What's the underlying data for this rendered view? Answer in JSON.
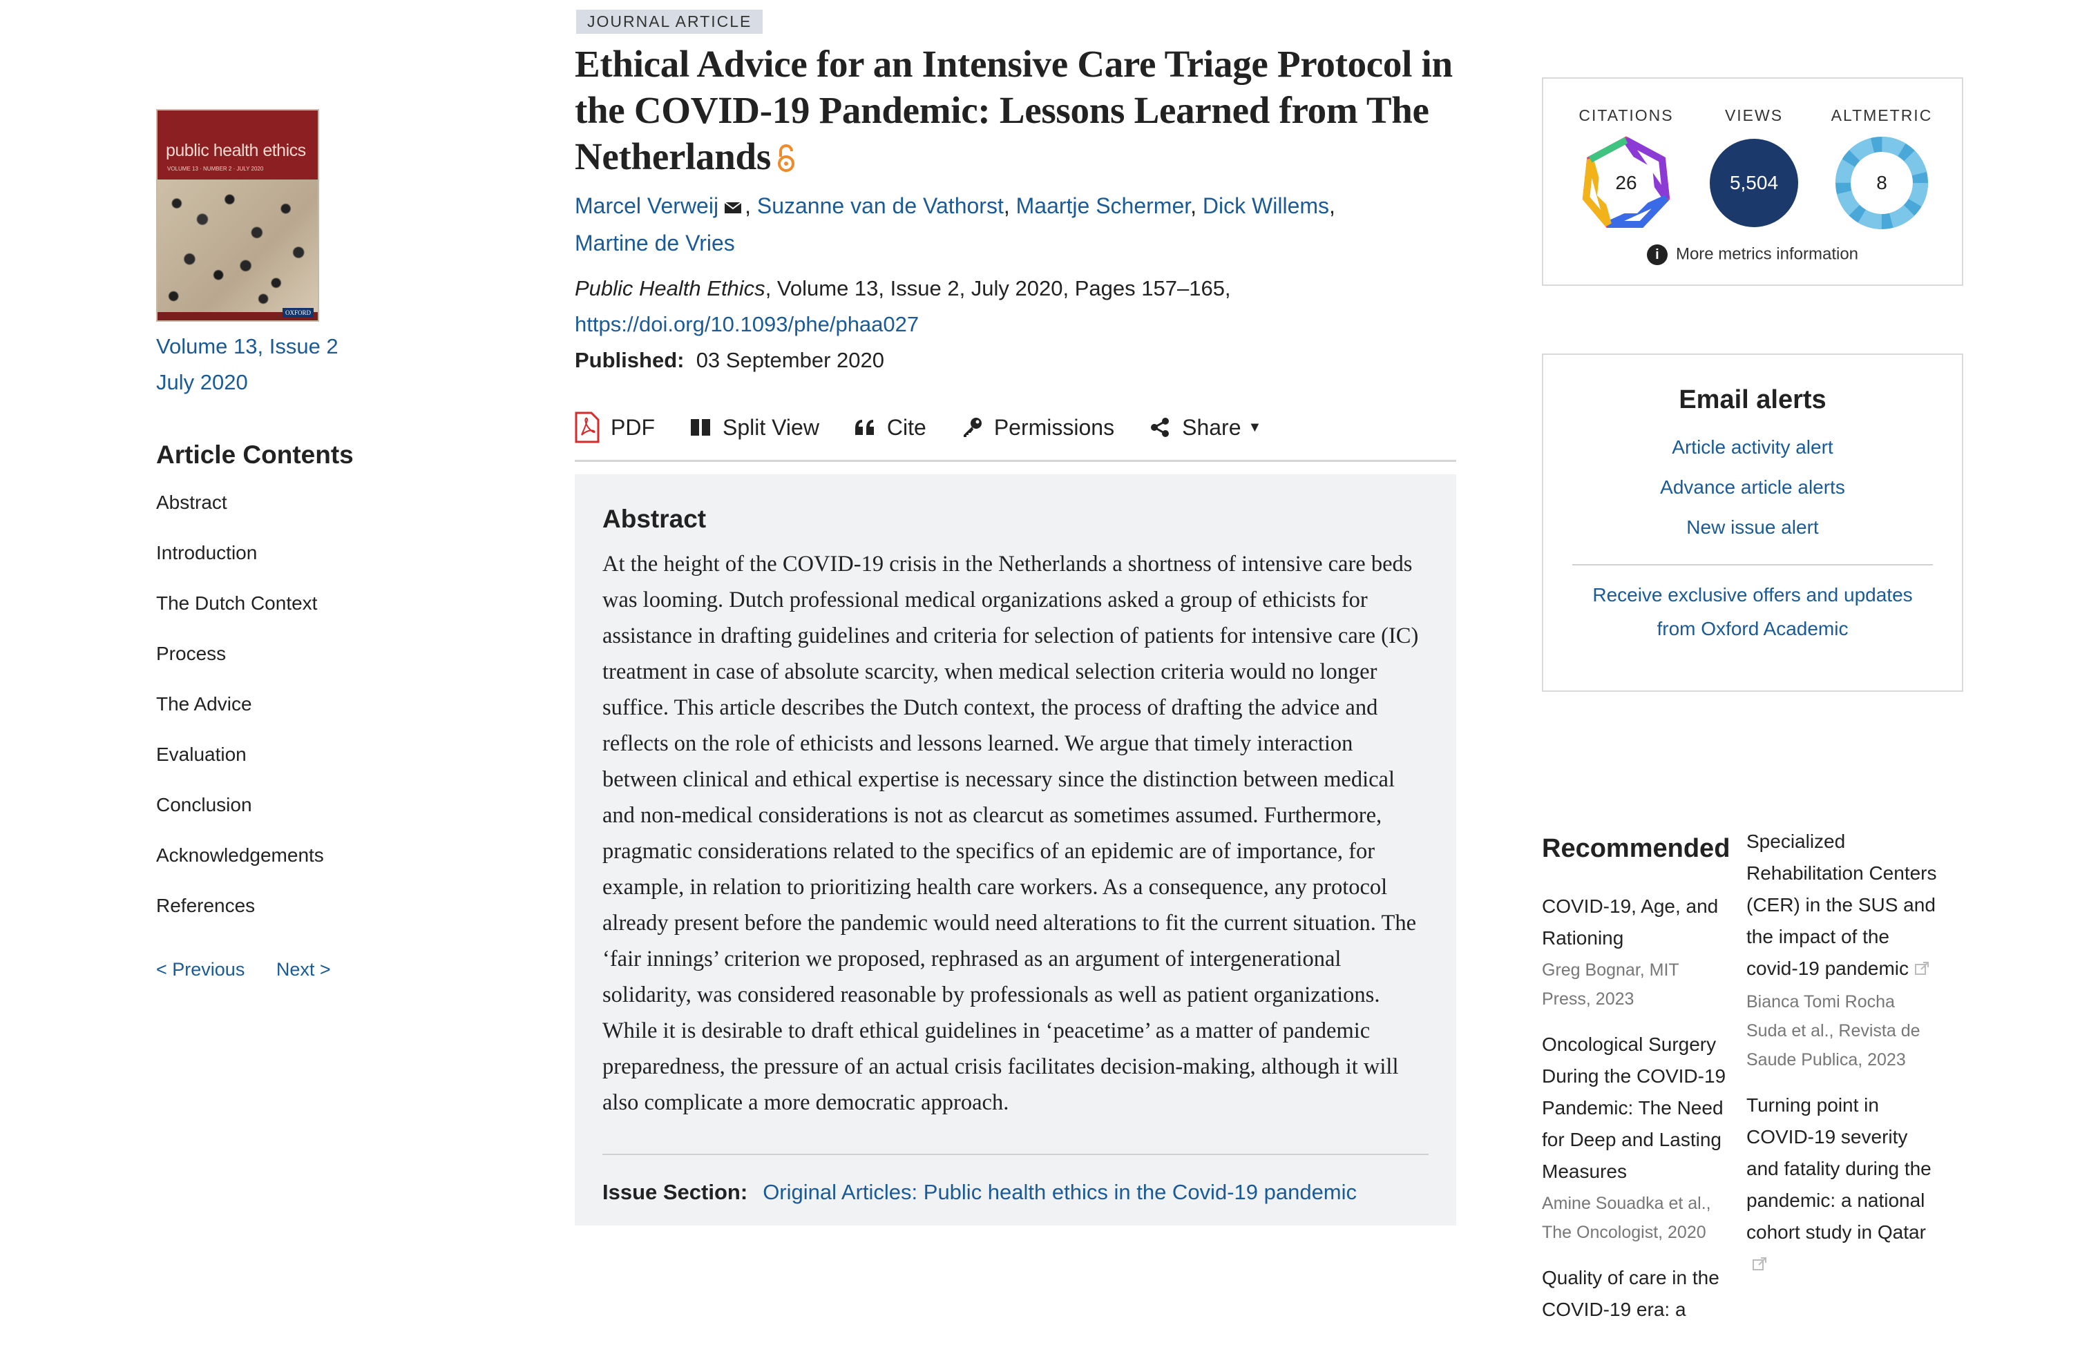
{
  "left": {
    "cover": {
      "journal": "public health ethics",
      "sub": "VOLUME 13 · NUMBER 2 · JULY 2020",
      "publisher": "OXFORD"
    },
    "issue_line1": "Volume 13, Issue 2",
    "issue_line2": "July 2020",
    "contents_title": "Article Contents",
    "contents": [
      "Abstract",
      "Introduction",
      "The Dutch Context",
      "Process",
      "The Advice",
      "Evaluation",
      "Conclusion",
      "Acknowledgements",
      "References"
    ],
    "prev": "< Previous",
    "next": "Next >"
  },
  "article": {
    "badge": "JOURNAL ARTICLE",
    "title": "Ethical Advice for an Intensive Care Triage Protocol in the COVID-19 Pandemic: Lessons Learned from The Netherlands",
    "authors": [
      "Marcel Verweij",
      "Suzanne van de Vathorst",
      "Maartje Schermer",
      "Dick Willems",
      "Martine de Vries"
    ],
    "journal_name": "Public Health Ethics",
    "citation_rest": ", Volume 13, Issue 2, July 2020, Pages 157–165,",
    "doi": "https://doi.org/10.1093/phe/phaa027",
    "published_label": "Published:",
    "published_date": "03 September 2020"
  },
  "toolbar": {
    "pdf": "PDF",
    "split": "Split View",
    "cite": "Cite",
    "permissions": "Permissions",
    "share": "Share"
  },
  "abstract": {
    "title": "Abstract",
    "text": "At the height of the COVID-19 crisis in the Netherlands a shortness of intensive care beds was looming. Dutch professional medical organizations asked a group of ethicists for assistance in drafting guidelines and criteria for selection of patients for intensive care (IC) treatment in case of absolute scarcity, when medical selection criteria would no longer suffice. This article describes the Dutch context, the process of drafting the advice and reflects on the role of ethicists and lessons learned. We argue that timely interaction between clinical and ethical expertise is necessary since the distinction between medical and non-medical considerations is not as clearcut as sometimes assumed. Furthermore, pragmatic considerations related to the specifics of an epidemic are of importance, for example, in relation to prioritizing health care workers. As a consequence, any protocol already present before the pandemic would need alterations to fit the current situation. The ‘fair innings’ criterion we proposed, rephrased as an argument of intergenerational solidarity, was considered reasonable by professionals as well as patient organizations. While it is desirable to draft ethical guidelines in ‘peacetime’ as a matter of pandemic preparedness, the pressure of an actual crisis facilitates decision-making, although it will also complicate a more democratic approach.",
    "issue_section_label": "Issue Section:",
    "issue_section_value": "Original Articles: Public health ethics in the Covid-19 pandemic"
  },
  "metrics": {
    "citations_label": "CITATIONS",
    "citations": "26",
    "views_label": "VIEWS",
    "views": "5,504",
    "altmetric_label": "ALTMETRIC",
    "altmetric": "8",
    "more": "More metrics information",
    "views_color": "#1b3a6b",
    "altmetric_color": "#4aa8d8"
  },
  "alerts": {
    "title": "Email alerts",
    "links": [
      "Article activity alert",
      "Advance article alerts",
      "New issue alert"
    ],
    "offers": "Receive exclusive offers and updates from Oxford Academic"
  },
  "recommended": {
    "title": "Recommended",
    "col1": [
      {
        "name": "COVID-19, Age, and Rationing",
        "meta": "Greg Bognar, MIT Press, 2023"
      },
      {
        "name": "Oncological Surgery During the COVID-19 Pandemic: The Need for Deep and Lasting Measures",
        "meta": "Amine Souadka et al., The Oncologist, 2020"
      },
      {
        "name": "Quality of care in the COVID-19 era: a",
        "meta": ""
      }
    ],
    "col2": [
      {
        "name": "Specialized Rehabilitation Centers (CER) in the SUS and the impact of the covid-19 pandemic",
        "meta": "Bianca Tomi Rocha Suda et al., Revista de Saude Publica, 2023"
      },
      {
        "name": "Turning point in COVID-19 severity and fatality during the pandemic: a national cohort study in Qatar",
        "meta": ""
      }
    ]
  }
}
